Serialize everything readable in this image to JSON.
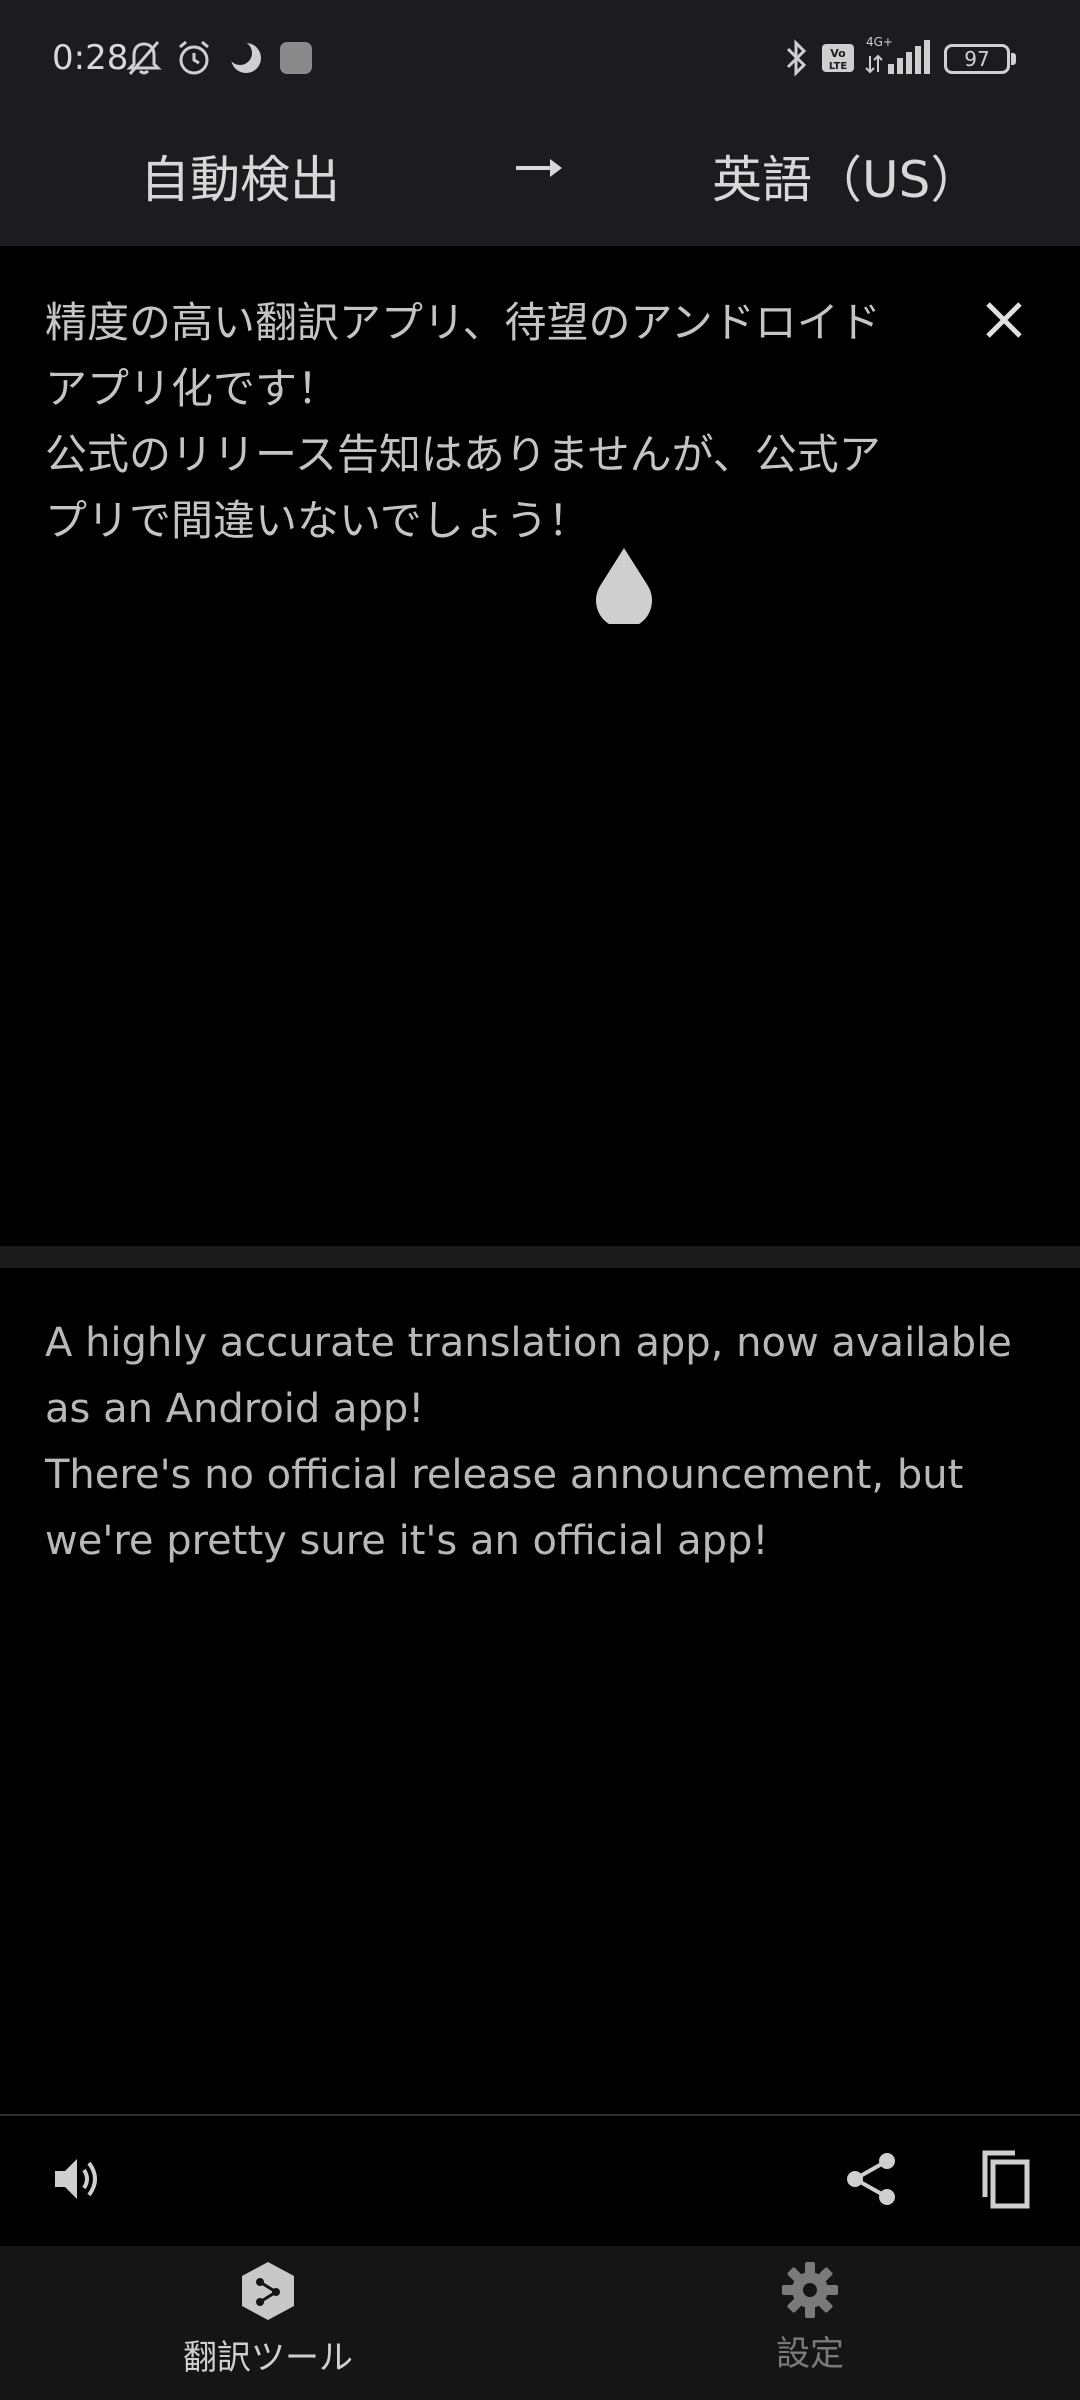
{
  "status_bar": {
    "time": "0:28",
    "battery": "97",
    "network": "4G+",
    "volte": "Vo LTE"
  },
  "language_bar": {
    "source_language": "自動検出",
    "target_language": "英語（US）"
  },
  "source": {
    "text": "精度の高い翻訳アプリ、待望のアンドロイド\nアプリ化です！\n公式のリリース告知はありませんが、公式ア\nプリで間違いないでしょう！"
  },
  "target": {
    "text": "A highly accurate translation app, now available\nas an Android app!\nThere's no official release announcement, but\nwe're pretty sure it's an official app!"
  },
  "bottom_nav": {
    "items": [
      {
        "label": "翻訳ツール",
        "icon": "deepl-logo-icon",
        "active": true
      },
      {
        "label": "設定",
        "icon": "gear-icon",
        "active": false
      }
    ]
  },
  "colors": {
    "background": "#000000",
    "bar": "#1c1c1e",
    "nav": "#151515",
    "text": "#c4c4c4",
    "inactive": "#7a7a7a"
  }
}
